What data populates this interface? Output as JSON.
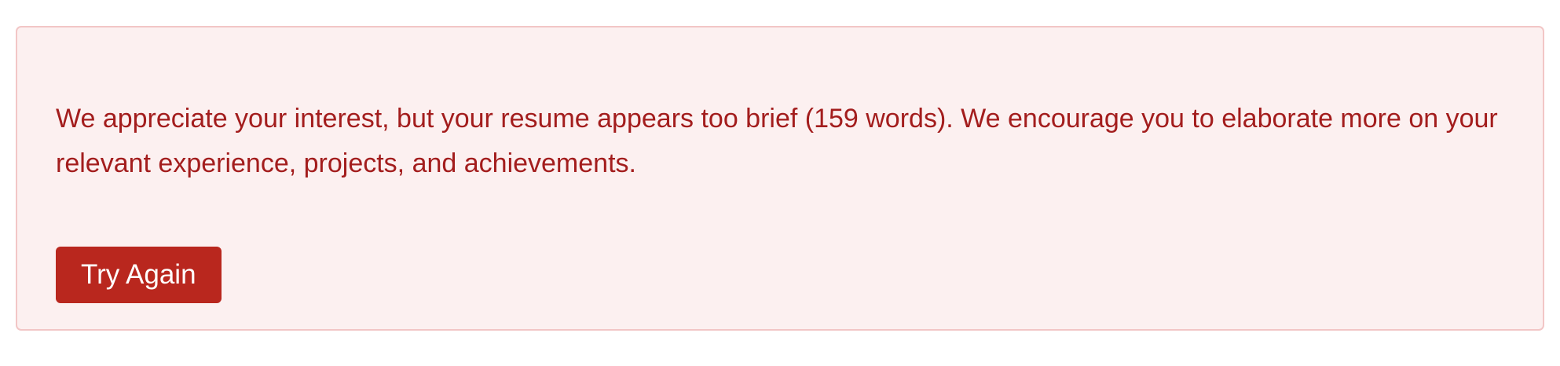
{
  "alert": {
    "message": "We appreciate your interest, but your resume appears too brief (159 words). We encourage you to elaborate more on your relevant experience, projects, and achievements.",
    "button_label": "Try Again",
    "colors": {
      "background": "#fcf0f0",
      "border": "#f2c6c6",
      "text": "#a31d1d",
      "button": "#b9271e",
      "button_text": "#ffffff"
    }
  }
}
